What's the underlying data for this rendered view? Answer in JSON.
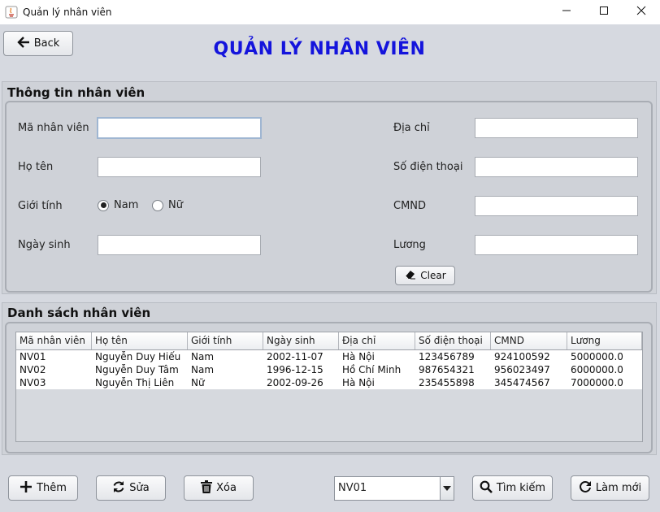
{
  "window": {
    "title": "Quản lý nhân viên",
    "controls": [
      "minimize-icon",
      "maximize-icon",
      "close-icon"
    ]
  },
  "header": {
    "back_label": "Back",
    "title": "QUẢN LÝ NHÂN VIÊN"
  },
  "info_panel": {
    "title": "Thông tin nhân viên",
    "fields": {
      "employee_id": {
        "label": "Mã nhân viên",
        "value": ""
      },
      "full_name": {
        "label": "Họ tên",
        "value": ""
      },
      "gender": {
        "label": "Giới tính",
        "options": [
          "Nam",
          "Nữ"
        ],
        "selected": "Nam"
      },
      "birthdate": {
        "label": "Ngày sinh",
        "value": ""
      },
      "address": {
        "label": "Địa chỉ",
        "value": ""
      },
      "phone": {
        "label": "Số điện thoại",
        "value": ""
      },
      "id_card": {
        "label": "CMND",
        "value": ""
      },
      "salary": {
        "label": "Lương",
        "value": ""
      }
    },
    "clear_label": "Clear"
  },
  "list_panel": {
    "title": "Danh sách nhân viên",
    "columns": [
      "Mã nhân viên",
      "Họ tên",
      "Giới tính",
      "Ngày sinh",
      "Địa chỉ",
      "Số điện thoại",
      "CMND",
      "Lương"
    ],
    "rows": [
      [
        "NV01",
        "Nguyễn Duy Hiếu",
        "Nam",
        "2002-11-07",
        "Hà Nội",
        "123456789",
        "924100592",
        "5000000.0"
      ],
      [
        "NV02",
        "Nguyễn Duy Tâm",
        "Nam",
        "1996-12-15",
        "Hồ Chí Minh",
        "987654321",
        "956023497",
        "6000000.0"
      ],
      [
        "NV03",
        "Nguyễn Thị Liên",
        "Nữ",
        "2002-09-26",
        "Hà Nội",
        "235455898",
        "345474567",
        "7000000.0"
      ]
    ]
  },
  "toolbar": {
    "add_label": "Thêm",
    "edit_label": "Sửa",
    "delete_label": "Xóa",
    "search_select": {
      "value": "NV01"
    },
    "search_label": "Tìm kiếm",
    "refresh_label": "Làm mới"
  },
  "colors": {
    "title_blue": "#1414dc",
    "background": "#d6d9e0"
  }
}
